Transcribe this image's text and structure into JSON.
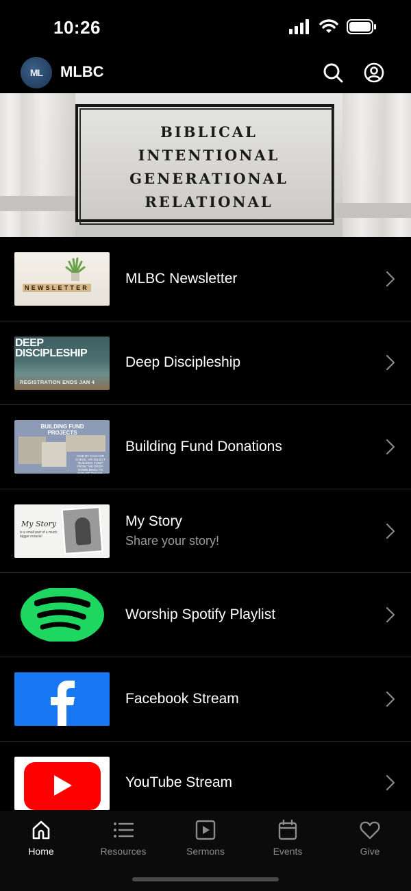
{
  "status": {
    "time": "10:26"
  },
  "header": {
    "logo_text": "ML",
    "title": "MLBC"
  },
  "banner": {
    "lines": [
      "BIBLICAL",
      "INTENTIONAL",
      "GENERATIONAL",
      "RELATIONAL"
    ]
  },
  "items": [
    {
      "title": "MLBC Newsletter",
      "subtitle": "",
      "thumb_text": "NEWSLETTER"
    },
    {
      "title": "Deep Discipleship",
      "subtitle": "",
      "thumb_title": "DEEP DISCIPLESHIP",
      "thumb_sub": "REGISTRATION ENDS JAN 4"
    },
    {
      "title": "Building Fund Donations",
      "subtitle": "",
      "thumb_title": "BUILDING FUND PROJECTS",
      "thumb_sub": "GIVE BY CASH OR CHECK, OR SELECT \"BUILDING FUND\" FROM THE DROP-DOWN MENU TO DONATE ONLINE."
    },
    {
      "title": "My Story",
      "subtitle": "Share your story!",
      "thumb_script": "My Story",
      "thumb_sub": "is a small part of a much bigger miracle!"
    },
    {
      "title": "Worship Spotify Playlist",
      "subtitle": ""
    },
    {
      "title": "Facebook Stream",
      "subtitle": ""
    },
    {
      "title": "YouTube Stream",
      "subtitle": ""
    }
  ],
  "tabs": [
    {
      "label": "Home",
      "icon": "home-icon",
      "active": true
    },
    {
      "label": "Resources",
      "icon": "list-icon",
      "active": false
    },
    {
      "label": "Sermons",
      "icon": "play-square-icon",
      "active": false
    },
    {
      "label": "Events",
      "icon": "calendar-icon",
      "active": false
    },
    {
      "label": "Give",
      "icon": "heart-icon",
      "active": false
    }
  ],
  "colors": {
    "background": "#000000",
    "spotify": "#1ed760",
    "facebook": "#1877f2",
    "youtube": "#ff0000"
  }
}
